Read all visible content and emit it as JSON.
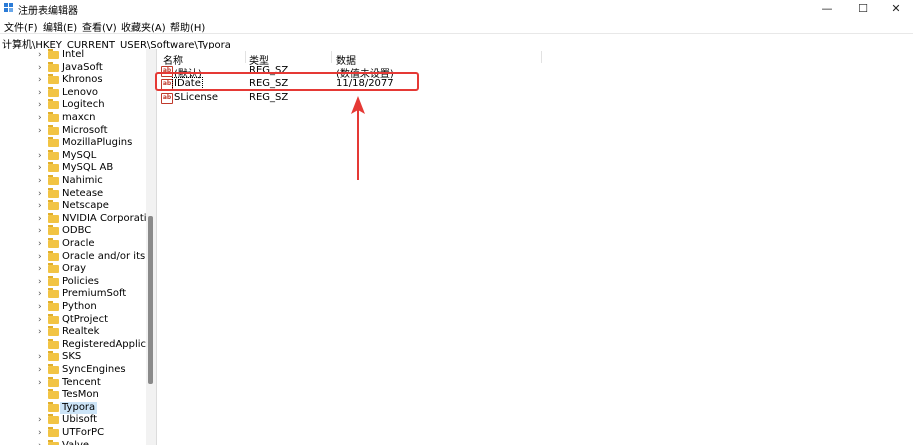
{
  "window": {
    "title": "注册表编辑器",
    "minimize_glyph": "—",
    "maximize_glyph": "☐",
    "close_glyph": "✕"
  },
  "menu": [
    "文件(F)",
    "编辑(E)",
    "查看(V)",
    "收藏夹(A)",
    "帮助(H)"
  ],
  "address": "计算机\\HKEY_CURRENT_USER\\Software\\Typora",
  "tree": {
    "items": [
      {
        "label": "Intel",
        "chevron": "›",
        "selected": false
      },
      {
        "label": "JavaSoft",
        "chevron": "›",
        "selected": false
      },
      {
        "label": "Khronos",
        "chevron": "›",
        "selected": false
      },
      {
        "label": "Lenovo",
        "chevron": "›",
        "selected": false
      },
      {
        "label": "Logitech",
        "chevron": "›",
        "selected": false
      },
      {
        "label": "maxcn",
        "chevron": "›",
        "selected": false
      },
      {
        "label": "Microsoft",
        "chevron": "›",
        "selected": false
      },
      {
        "label": "MozillaPlugins",
        "chevron": "",
        "selected": false
      },
      {
        "label": "MySQL",
        "chevron": "›",
        "selected": false
      },
      {
        "label": "MySQL AB",
        "chevron": "›",
        "selected": false
      },
      {
        "label": "Nahimic",
        "chevron": "›",
        "selected": false
      },
      {
        "label": "Netease",
        "chevron": "›",
        "selected": false
      },
      {
        "label": "Netscape",
        "chevron": "›",
        "selected": false
      },
      {
        "label": "NVIDIA Corporation",
        "chevron": "›",
        "selected": false
      },
      {
        "label": "ODBC",
        "chevron": "›",
        "selected": false
      },
      {
        "label": "Oracle",
        "chevron": "›",
        "selected": false
      },
      {
        "label": "Oracle and/or its af",
        "chevron": "›",
        "selected": false
      },
      {
        "label": "Oray",
        "chevron": "›",
        "selected": false
      },
      {
        "label": "Policies",
        "chevron": "›",
        "selected": false
      },
      {
        "label": "PremiumSoft",
        "chevron": "›",
        "selected": false
      },
      {
        "label": "Python",
        "chevron": "›",
        "selected": false
      },
      {
        "label": "QtProject",
        "chevron": "›",
        "selected": false
      },
      {
        "label": "Realtek",
        "chevron": "›",
        "selected": false
      },
      {
        "label": "RegisteredApplicat",
        "chevron": "",
        "selected": false
      },
      {
        "label": "SKS",
        "chevron": "›",
        "selected": false
      },
      {
        "label": "SyncEngines",
        "chevron": "›",
        "selected": false
      },
      {
        "label": "Tencent",
        "chevron": "›",
        "selected": false
      },
      {
        "label": "TesMon",
        "chevron": "",
        "selected": false
      },
      {
        "label": "Typora",
        "chevron": "",
        "selected": true
      },
      {
        "label": "Ubisoft",
        "chevron": "›",
        "selected": false
      },
      {
        "label": "UTForPC",
        "chevron": "›",
        "selected": false
      },
      {
        "label": "Valve",
        "chevron": "›",
        "selected": false
      }
    ]
  },
  "values": {
    "headers": {
      "name": "名称",
      "type": "类型",
      "data": "数据"
    },
    "rows": [
      {
        "icon": "ab",
        "name": "(默认)",
        "type": "REG_SZ",
        "data": "(数值未设置)"
      },
      {
        "icon": "ab",
        "name": "IDate",
        "type": "REG_SZ",
        "data": "11/18/2077"
      },
      {
        "icon": "ab",
        "name": "SLicense",
        "type": "REG_SZ",
        "data": ""
      }
    ]
  },
  "annotation": {
    "highlight_color": "#e53935"
  },
  "colors": {
    "selection": "#cce4f7",
    "folder": "#f2c444"
  }
}
